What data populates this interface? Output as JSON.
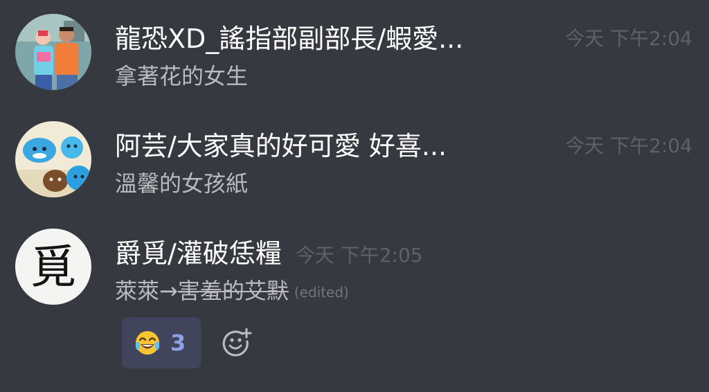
{
  "messages": [
    {
      "username": "龍恐XD_謠指部副部長/蝦愛...",
      "timestamp": "今天 下午2:04",
      "content": "拿著花的女生"
    },
    {
      "username": "阿芸/大家真的好可愛 好喜...",
      "timestamp": "今天 下午2:04",
      "content": "溫馨的女孩紙"
    },
    {
      "username": "爵覓/灌破恁糧",
      "timestamp": "今天 下午2:05",
      "content_plain": "萊萊→",
      "content_struck": "害羞的艾默",
      "edited_label": "(edited)",
      "avatar_glyph": "覓",
      "reaction": {
        "emoji": "😂",
        "count": "3"
      },
      "add_reaction_icon": "add-reaction-smiley-icon"
    }
  ],
  "colors": {
    "background": "#36393f",
    "username": "#ffffff",
    "content": "#b9bbbe",
    "timestamp": "#5e6168",
    "reaction_bg": "#40455b",
    "reaction_count": "#8fa1e5"
  }
}
